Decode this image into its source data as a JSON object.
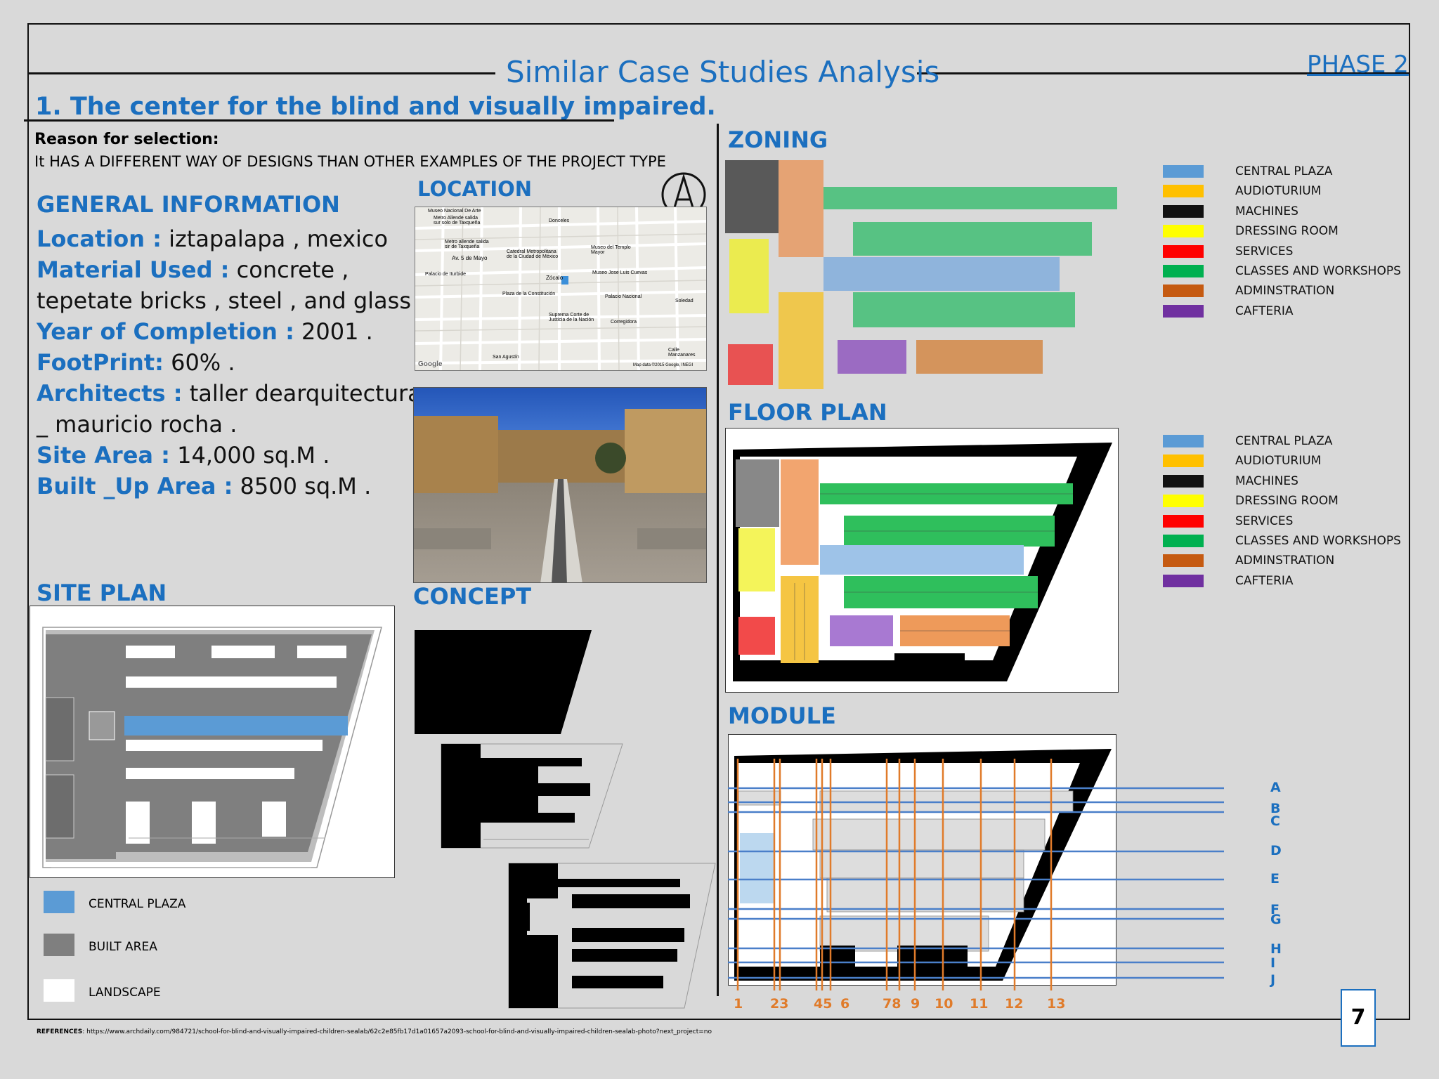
{
  "header": {
    "title": "Similar Case Studies Analysis",
    "phase": "PHASE 2"
  },
  "project": {
    "heading": "1. The center for the blind and visually impaired.",
    "reason_label": "Reason for selection:",
    "reason_text": "It HAS A DIFFERENT WAY OF DESIGNS THAN OTHER EXAMPLES OF THE PROJECT TYPE"
  },
  "sections": {
    "general": "GENERAL INFORMATION",
    "location": "LOCATION",
    "concept": "CONCEPT",
    "site_plan": "SITE PLAN",
    "zoning": "ZONING",
    "floor_plan": "FLOOR PLAN",
    "module": "MODULE"
  },
  "info": [
    {
      "key": "Location :",
      "value": " iztapalapa , mexico"
    },
    {
      "key": "Material Used :",
      "value": " concrete , tepetate bricks , steel , and glass"
    },
    {
      "key": "Year of Completion :",
      "value": " 2001 ."
    },
    {
      "key": "FootPrint:",
      "value": " 60% ."
    },
    {
      "key": "Architects :",
      "value": " taller dearquitectura _ mauricio rocha ."
    },
    {
      "key": " Site Area :",
      "value": " 14,000 sq.M ."
    },
    {
      "key": "Built _Up Area :",
      "value": " 8500 sq.M ."
    }
  ],
  "map_labels": {
    "museo": "Museo Nacional De Arte",
    "metro1": "Metro Allende salida sur solo de Taxqueña",
    "metro2": "Metro allende salida sir de Taxqueña",
    "mayo": "Av. 5 de Mayo",
    "catedral": "Catedral Metropolitana de la Ciudad de México",
    "templo": "Museo del Templo Mayor",
    "iturbide": "Palacio de Iturbide",
    "zocalo": "Zócalo",
    "cuevas": "Museo Jose Luis Cuevas",
    "plaza": "Plaza de la Constitución",
    "nacional": "Palacio Nacional",
    "corte": "Suprema Corte de Justicia de la Nación",
    "corregidora": "Corregidora",
    "soledad": "Soledad",
    "sanagustin": "San Agustín",
    "manzanares": "Calle Manzanares",
    "donceles": "Donceles",
    "credit": "Map data ©2015 Google, INEGI",
    "google": "Google"
  },
  "legend": [
    {
      "label": "CENTRAL PLAZA",
      "color": "#5b9bd5"
    },
    {
      "label": "AUDIOTURIUM",
      "color": "#ffc000"
    },
    {
      "label": "MACHINES",
      "color": "#111111"
    },
    {
      "label": "DRESSING ROOM",
      "color": "#ffff00"
    },
    {
      "label": "SERVICES",
      "color": "#ff0000"
    },
    {
      "label": "CLASSES AND WORKSHOPS",
      "color": "#00b050"
    },
    {
      "label": "ADMINSTRATION",
      "color": "#c55a11"
    },
    {
      "label": "CAFTERIA",
      "color": "#7030a0"
    }
  ],
  "site_legend": [
    {
      "label": "CENTRAL PLAZA",
      "color": "#5b9bd5"
    },
    {
      "label": "BUILT AREA",
      "color": "#7f7f7f"
    },
    {
      "label": "LANDSCAPE",
      "color": "#ffffff"
    }
  ],
  "module": {
    "columns": [
      "1",
      "23",
      "45",
      "6",
      "78",
      "9",
      "10",
      "11",
      "12",
      "13"
    ],
    "rows": [
      "A",
      "B",
      "C",
      "D",
      "E",
      "F",
      "G",
      "H",
      "I",
      "J"
    ]
  },
  "page_number": "7",
  "references": {
    "label": "REFERENCES",
    "url": ": https://www.archdaily.com/984721/school-for-blind-and-visually-impaired-children-sealab/62c2e85fb17d1a01657a2093-school-for-blind-and-visually-impaired-children-sealab-photo?next_project=no"
  }
}
